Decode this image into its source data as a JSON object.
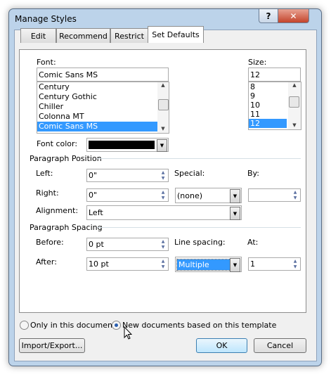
{
  "window": {
    "title": "Manage Styles",
    "help": "?",
    "close": "✕"
  },
  "tabs": [
    "Edit",
    "Recommend",
    "Restrict",
    "Set Defaults"
  ],
  "font": {
    "label": "Font:",
    "value": "Comic Sans MS",
    "options": [
      "Century",
      "Century Gothic",
      "Chiller",
      "Colonna MT",
      "Comic Sans MS"
    ],
    "selected": "Comic Sans MS"
  },
  "size": {
    "label": "Size:",
    "value": "12",
    "options": [
      "8",
      "9",
      "10",
      "11",
      "12"
    ],
    "selected": "12"
  },
  "font_color": {
    "label": "Font color:",
    "value": "#000000"
  },
  "paragraph_position": {
    "heading": "Paragraph Position",
    "left_label": "Left:",
    "left": "0\"",
    "right_label": "Right:",
    "right": "0\"",
    "special_label": "Special:",
    "special": "(none)",
    "by_label": "By:",
    "by": "",
    "alignment_label": "Alignment:",
    "alignment": "Left"
  },
  "paragraph_spacing": {
    "heading": "Paragraph Spacing",
    "before_label": "Before:",
    "before": "0 pt",
    "after_label": "After:",
    "after": "10 pt",
    "line_spacing_label": "Line spacing:",
    "line_spacing": "Multiple",
    "at_label": "At:",
    "at": "1"
  },
  "scope": {
    "option1": "Only in this document",
    "option2": "New documents based on this template",
    "selected": "option2"
  },
  "buttons": {
    "import_export": "Import/Export...",
    "ok": "OK",
    "cancel": "Cancel"
  }
}
